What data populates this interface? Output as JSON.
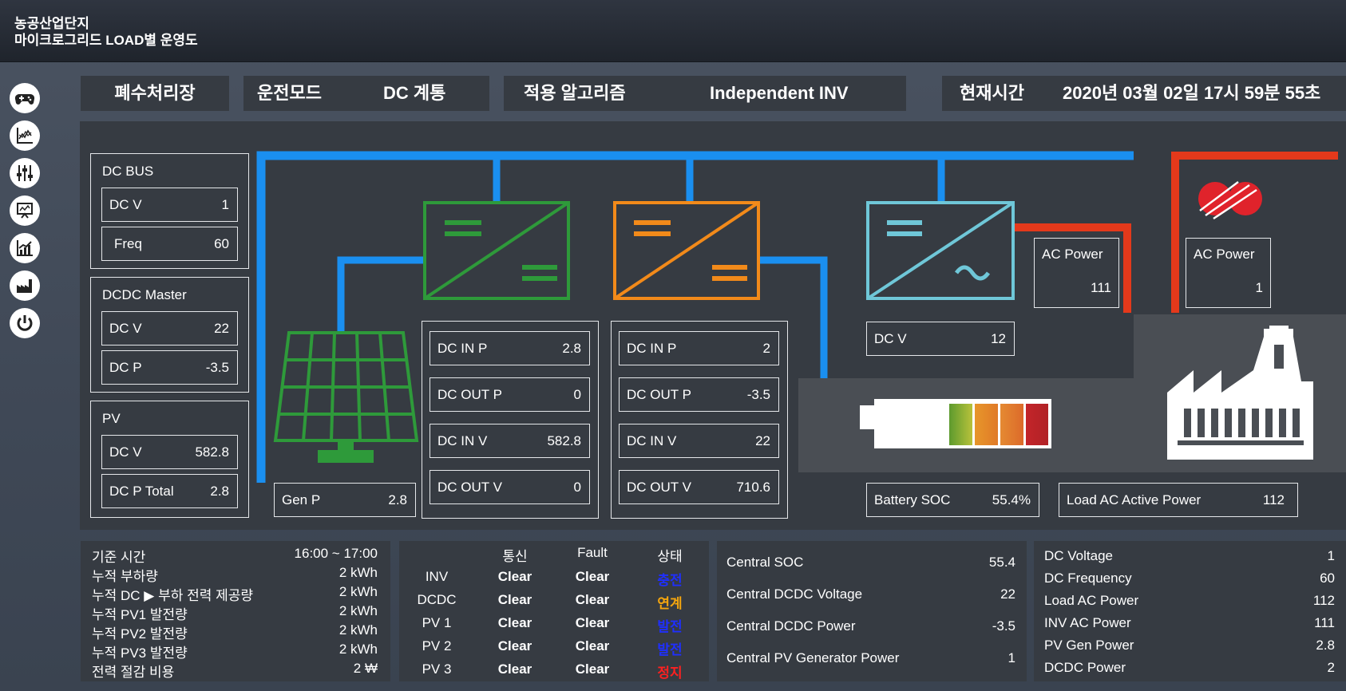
{
  "header": {
    "line1": "농공산업단지",
    "line2": "마이크로그리드 LOAD별 운영도"
  },
  "sidebar": {
    "icons": [
      "gamepad-icon",
      "chart-icon",
      "sliders-icon",
      "monitor-icon",
      "trend-icon",
      "factory-icon",
      "power-icon"
    ]
  },
  "topbar": {
    "site": "폐수처리장",
    "mode_label": "운전모드",
    "mode_value": "DC 계통",
    "algo_label": "적용 알고리즘",
    "algo_value": "Independent INV",
    "time_label": "현재시간",
    "time_value": "2020년 03월 02일 17시 59분 55초"
  },
  "left": {
    "dcbus": {
      "title": "DC BUS",
      "dcv_label": "DC V",
      "dcv": "1",
      "freq_label": "Freq",
      "freq": "60"
    },
    "dcdc": {
      "title": "DCDC Master",
      "dcv_label": "DC V",
      "dcv": "22",
      "dcp_label": "DC P",
      "dcp": "-3.5"
    },
    "pv": {
      "title": "PV",
      "dcv_label": "DC V",
      "dcv": "582.8",
      "dcp_label": "DC P Total",
      "dcp": "2.8"
    }
  },
  "diagram": {
    "genp_label": "Gen P",
    "genp": "2.8",
    "conv1": [
      {
        "k": "DC IN P",
        "v": "2.8"
      },
      {
        "k": "DC OUT P",
        "v": "0"
      },
      {
        "k": "DC IN V",
        "v": "582.8"
      },
      {
        "k": "DC OUT V",
        "v": "0"
      }
    ],
    "conv2": [
      {
        "k": "DC IN P",
        "v": "2"
      },
      {
        "k": "DC OUT P",
        "v": "-3.5"
      },
      {
        "k": "DC IN V",
        "v": "22"
      },
      {
        "k": "DC OUT V",
        "v": "710.6"
      }
    ],
    "inv_dcv_label": "DC V",
    "inv_dcv": "12",
    "acpower1_label": "AC Power",
    "acpower1": "111",
    "acpower2_label": "AC Power",
    "acpower2": "1",
    "soc_label": "Battery SOC",
    "soc": "55.4%",
    "load_label": "Load AC Active Power",
    "load": "112",
    "colors": {
      "dcline": "#1a8ff0",
      "acline": "#e4391b",
      "pvgreen": "#2e9a3a",
      "dcdcorange": "#f28a1a",
      "invcyan": "#6fc7d8"
    }
  },
  "summary": {
    "rows": [
      {
        "k": "기준 시간",
        "v": "16:00 ~ 17:00"
      },
      {
        "k": "누적 부하량",
        "v": "2 kWh"
      },
      {
        "k": "누적 DC ▶ 부하 전력 제공량",
        "v": "2 kWh"
      },
      {
        "k": "누적 PV1 발전량",
        "v": "2 kWh"
      },
      {
        "k": "누적 PV2 발전량",
        "v": "2 kWh"
      },
      {
        "k": "누적 PV3 발전량",
        "v": "2 kWh"
      },
      {
        "k": "전력 절감 비용",
        "v": "2 ₩"
      }
    ]
  },
  "status": {
    "headers": [
      "통신",
      "Fault",
      "상태"
    ],
    "rows": [
      {
        "name": "INV",
        "comm": "Clear",
        "fault": "Clear",
        "state": "충전",
        "color": "#1f2fff"
      },
      {
        "name": "DCDC",
        "comm": "Clear",
        "fault": "Clear",
        "state": "연계",
        "color": "#f5a60e"
      },
      {
        "name": "PV 1",
        "comm": "Clear",
        "fault": "Clear",
        "state": "발전",
        "color": "#1f2fff"
      },
      {
        "name": "PV 2",
        "comm": "Clear",
        "fault": "Clear",
        "state": "발전",
        "color": "#1f2fff"
      },
      {
        "name": "PV 3",
        "comm": "Clear",
        "fault": "Clear",
        "state": "정지",
        "color": "#ff2020"
      }
    ]
  },
  "central": [
    {
      "k": "Central SOC",
      "v": "55.4"
    },
    {
      "k": "Central DCDC Voltage",
      "v": "22"
    },
    {
      "k": "Central DCDC Power",
      "v": "-3.5"
    },
    {
      "k": "Central PV Generator Power",
      "v": "1"
    }
  ],
  "dc": [
    {
      "k": "DC Voltage",
      "v": "1"
    },
    {
      "k": "DC Frequency",
      "v": "60"
    },
    {
      "k": "Load AC Power",
      "v": "112"
    },
    {
      "k": "INV AC Power",
      "v": "111"
    },
    {
      "k": "PV Gen Power",
      "v": "2.8"
    },
    {
      "k": "DCDC Power",
      "v": "2"
    }
  ]
}
